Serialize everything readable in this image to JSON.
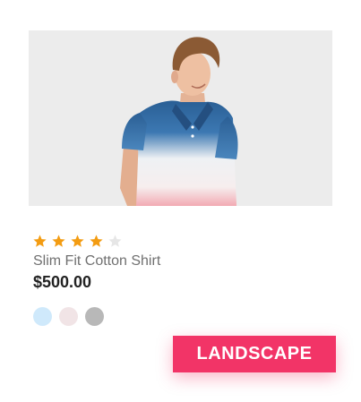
{
  "product": {
    "image_alt": "Man wearing blue-to-white ombre polo shirt",
    "rating": {
      "value": 4,
      "max": 5,
      "filled_color": "#f39c12",
      "empty_color": "#e6e6e6"
    },
    "title": "Slim Fit Cotton Shirt",
    "price": "$500.00",
    "swatches": [
      {
        "name": "light-blue",
        "color": "#cfe9fb"
      },
      {
        "name": "light-pink",
        "color": "#f1e4e6"
      },
      {
        "name": "gray",
        "color": "#b8b8b8"
      }
    ]
  },
  "badge": {
    "label": "LANDSCAPE",
    "color": "#f23467"
  }
}
